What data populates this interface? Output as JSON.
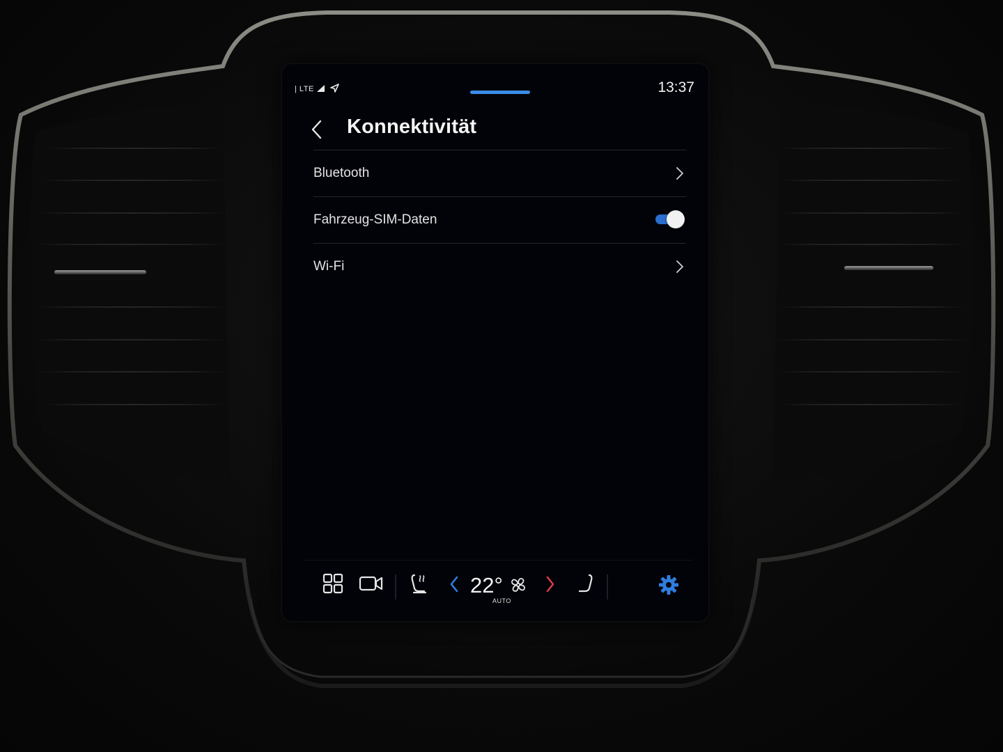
{
  "status_bar": {
    "signal_text": "LTE",
    "time": "13:37",
    "accent_color": "#3a8de8"
  },
  "header": {
    "back_icon": "chevron-left-icon",
    "title": "Konnektivität"
  },
  "settings_list": [
    {
      "label": "Bluetooth",
      "control": "chevron-right-icon"
    },
    {
      "label": "Fahrzeug-SIM-Daten",
      "control": "toggle",
      "toggle_on": true
    },
    {
      "label": "Wi-Fi",
      "control": "chevron-right-icon"
    }
  ],
  "climate_bar": {
    "icons": {
      "home": "app-grid-icon",
      "camera": "camera-icon",
      "driver_seat": "driver-seat-heating-icon",
      "temp_down": "chevron-left-icon",
      "temp_up": "chevron-right-icon",
      "fan": "fan-icon",
      "passenger_seat": "passenger-seat-icon",
      "settings": "gear-icon"
    },
    "temperature": "22°",
    "mode": "AUTO",
    "colors": {
      "temp_down": "#2f7de0",
      "temp_up": "#d83a48",
      "settings": "#2f7de0",
      "toggle_on": "#2a6fd0"
    }
  }
}
